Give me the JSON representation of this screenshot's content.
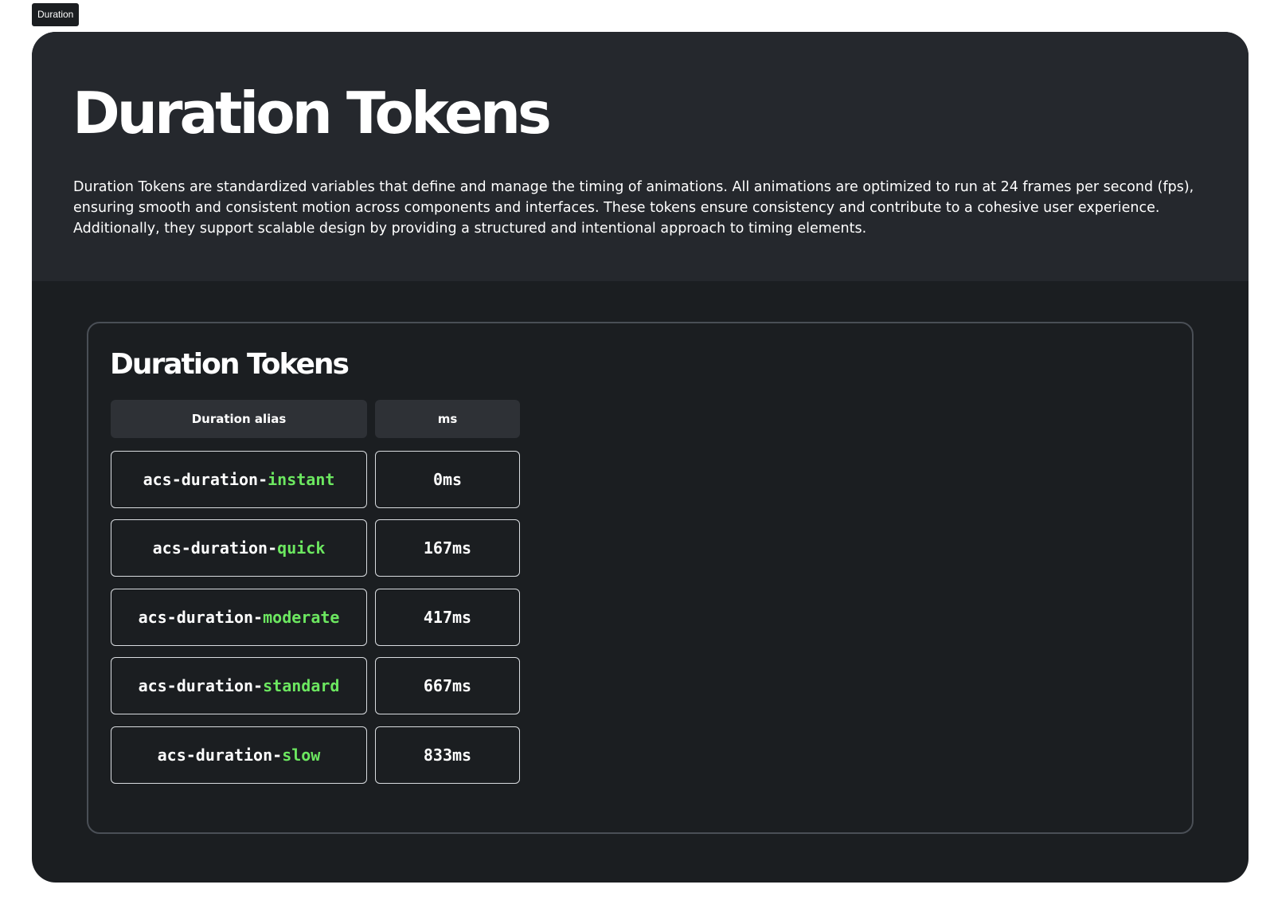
{
  "frame_tag": "Duration",
  "hero": {
    "title": "Duration Tokens",
    "description": "Duration Tokens are standardized variables that define and manage the timing of animations. All animations are optimized to run at 24 frames per second (fps), ensuring smooth and consistent motion across components and interfaces. These tokens ensure consistency and contribute to a cohesive user experience. Additionally, they support scalable design by providing a structured and intentional approach to timing elements."
  },
  "panel": {
    "title": "Duration Tokens",
    "headers": {
      "alias": "Duration alias",
      "ms": "ms"
    },
    "rows": [
      {
        "prefix": "acs-duration-",
        "name": "instant",
        "ms": "0ms"
      },
      {
        "prefix": "acs-duration-",
        "name": "quick",
        "ms": "167ms"
      },
      {
        "prefix": "acs-duration-",
        "name": "moderate",
        "ms": "417ms"
      },
      {
        "prefix": "acs-duration-",
        "name": "standard",
        "ms": "667ms"
      },
      {
        "prefix": "acs-duration-",
        "name": "slow",
        "ms": "833ms"
      }
    ]
  },
  "colors": {
    "card_background": "#1b1e21",
    "hero_background": "#25282d",
    "accent": "#6ce760",
    "header_cell": "#2e3136"
  }
}
